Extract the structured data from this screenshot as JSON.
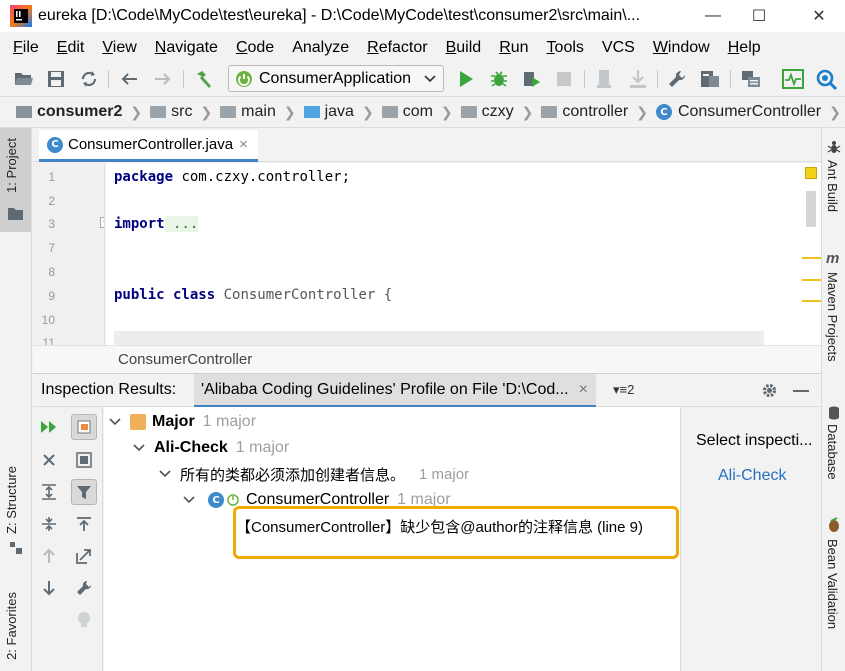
{
  "window": {
    "title": "eureka [D:\\Code\\MyCode\\test\\eureka] - D:\\Code\\MyCode\\test\\consumer2\\src\\main\\...",
    "minimize": "—",
    "maximize": "☐",
    "close": "✕"
  },
  "menu": {
    "items": [
      {
        "u": "F",
        "rest": "ile"
      },
      {
        "u": "E",
        "rest": "dit"
      },
      {
        "u": "V",
        "rest": "iew"
      },
      {
        "u": "N",
        "rest": "avigate"
      },
      {
        "u": "C",
        "rest": "ode"
      },
      {
        "u": "",
        "rest": "Analyze"
      },
      {
        "u": "R",
        "rest": "efactor"
      },
      {
        "u": "B",
        "rest": "uild"
      },
      {
        "u": "R",
        "rest": "un"
      },
      {
        "u": "T",
        "rest": "ools"
      },
      {
        "u": "",
        "rest": "VCS"
      },
      {
        "u": "W",
        "rest": "indow"
      },
      {
        "u": "H",
        "rest": "elp"
      }
    ]
  },
  "toolbar": {
    "run_config": "ConsumerApplication"
  },
  "breadcrumb": {
    "items": [
      "consumer2",
      "src",
      "main",
      "java",
      "com",
      "czxy",
      "controller",
      "ConsumerController"
    ]
  },
  "left_strip": {
    "project": "1: Project",
    "structure": "Z: Structure",
    "favorites": "2: Favorites"
  },
  "right_strip": {
    "ant": "Ant Build",
    "maven": "Maven Projects",
    "database": "Database",
    "bean": "Bean Validation"
  },
  "editor": {
    "tab_label": "ConsumerController.java",
    "tab_close": "×",
    "line_numbers": [
      "1",
      "2",
      "3",
      "7",
      "8",
      "9",
      "10",
      "11"
    ],
    "code": {
      "l1_kw": "package",
      "l1_rest": " com.czxy.controller;",
      "l3_kw": "import",
      "l3_rest": " ...",
      "l9_kw": "public class",
      "l9_rest": " ConsumerController {"
    },
    "footer": "ConsumerController"
  },
  "inspection": {
    "title": "Inspection Results:",
    "tab_label": "'Alibaba Coding Guidelines' Profile on File 'D:\\Cod...",
    "tab_close": "×",
    "tab_extra": "2",
    "tree": {
      "major_label": "Major",
      "major_count": "1 major",
      "alicheck_label": "Ali-Check",
      "alicheck_count": "1 major",
      "rule_label": "所有的类都必须添加创建者信息。",
      "rule_count": "1 major",
      "class_label": "ConsumerController",
      "class_count": "1 major",
      "problem": "【ConsumerController】缺少包含@author的注释信息 (line 9)"
    },
    "details": {
      "title": "Select inspecti...",
      "link": "Ali-Check"
    }
  },
  "colors": {
    "accent_blue": "#4083c9",
    "run_green": "#3ba53b",
    "highlight": "#f2a900",
    "keyword": "#000080"
  }
}
